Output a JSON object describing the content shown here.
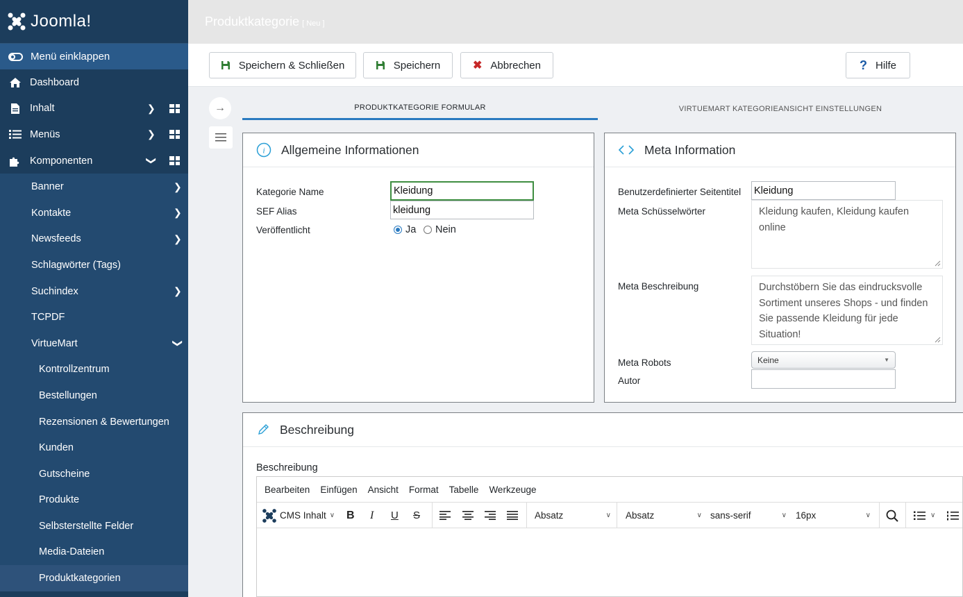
{
  "app": {
    "brand": "Joomla!",
    "page_title": "Produktkategorie",
    "page_badge": "[ Neu ]"
  },
  "sidebar": {
    "collapse_label": "Menü einklappen",
    "items": [
      {
        "label": "Dashboard",
        "icon": "home-icon"
      },
      {
        "label": "Inhalt",
        "icon": "file-icon"
      },
      {
        "label": "Menüs",
        "icon": "list-icon"
      },
      {
        "label": "Komponenten",
        "icon": "puzzle-icon"
      },
      {
        "label": "Banner"
      },
      {
        "label": "Kontakte"
      },
      {
        "label": "Newsfeeds"
      },
      {
        "label": "Schlagwörter (Tags)"
      },
      {
        "label": "Suchindex"
      },
      {
        "label": "TCPDF"
      },
      {
        "label": "VirtueMart"
      },
      {
        "label": "Kontrollzentrum"
      },
      {
        "label": "Bestellungen"
      },
      {
        "label": "Rezensionen & Bewertungen"
      },
      {
        "label": "Kunden"
      },
      {
        "label": "Gutscheine"
      },
      {
        "label": "Produkte"
      },
      {
        "label": "Selbsterstellte Felder"
      },
      {
        "label": "Media-Dateien"
      },
      {
        "label": "Produktkategorien"
      }
    ]
  },
  "toolbar": {
    "save_close": "Speichern & Schließen",
    "save": "Speichern",
    "cancel": "Abbrechen",
    "help": "Hilfe"
  },
  "tabs": [
    {
      "label": "PRODUKTKATEGORIE FORMULAR"
    },
    {
      "label": "VIRTUEMART KATEGORIEANSICHT EINSTELLUNGEN"
    }
  ],
  "general": {
    "title": "Allgemeine Informationen",
    "name_label": "Kategorie Name",
    "name_value": "Kleidung",
    "alias_label": "SEF Alias",
    "alias_value": "kleidung",
    "published_label": "Veröffentlicht",
    "yes": "Ja",
    "no": "Nein"
  },
  "meta": {
    "title": "Meta Information",
    "page_title_label": "Benutzerdefinierter Seitentitel",
    "page_title_value": "Kleidung",
    "keywords_label": "Meta Schüsselwörter",
    "keywords_value": "Kleidung kaufen, Kleidung kaufen online",
    "description_label": "Meta Beschreibung",
    "description_value": "Durchstöbern Sie das eindrucksvolle Sortiment unseres Shops - und finden Sie passende Kleidung für jede Situation!",
    "robots_label": "Meta Robots",
    "robots_value": "Keine",
    "author_label": "Autor",
    "author_value": ""
  },
  "description": {
    "title": "Beschreibung",
    "field_label": "Beschreibung",
    "menubar": [
      "Bearbeiten",
      "Einfügen",
      "Ansicht",
      "Format",
      "Tabelle",
      "Werkzeuge"
    ],
    "cms_label": "CMS Inhalt",
    "block1": "Absatz",
    "block2": "Absatz",
    "font": "sans-serif",
    "size": "16px"
  }
}
